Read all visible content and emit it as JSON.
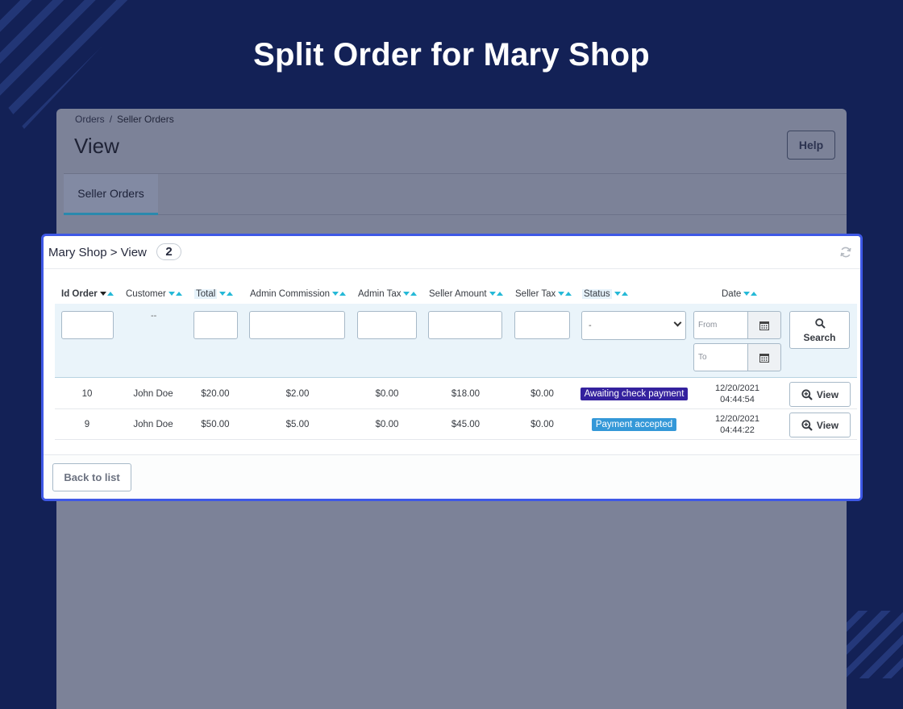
{
  "hero": {
    "title": "Split Order for Mary Shop"
  },
  "backdrop": {
    "breadcrumb": [
      "Orders",
      "Seller Orders"
    ],
    "breadcrumb_sep": "/",
    "title": "View",
    "help_label": "Help",
    "tabs": [
      {
        "label": "Seller Orders",
        "active": true
      }
    ]
  },
  "panel": {
    "title": "Mary Shop > View",
    "count": "2",
    "columns": [
      {
        "label": "Id Order"
      },
      {
        "label": "Customer"
      },
      {
        "label": "Total"
      },
      {
        "label": "Admin Commission"
      },
      {
        "label": "Admin Tax"
      },
      {
        "label": "Seller Amount"
      },
      {
        "label": "Seller Tax"
      },
      {
        "label": "Status"
      },
      {
        "label": "Date"
      }
    ],
    "filters": {
      "customer_placeholder": "--",
      "status_selected": "-",
      "date_from_placeholder": "From",
      "date_to_placeholder": "To",
      "search_label": "Search"
    },
    "rows": [
      {
        "id": "10",
        "customer": "John Doe",
        "total": "$20.00",
        "admin_commission": "$2.00",
        "admin_tax": "$0.00",
        "seller_amount": "$18.00",
        "seller_tax": "$0.00",
        "status": "Awaiting check payment",
        "status_color": "#34219e",
        "date": "12/20/2021",
        "time": "04:44:54",
        "action": "View"
      },
      {
        "id": "9",
        "customer": "John Doe",
        "total": "$50.00",
        "admin_commission": "$5.00",
        "admin_tax": "$0.00",
        "seller_amount": "$45.00",
        "seller_tax": "$0.00",
        "status": "Payment accepted",
        "status_color": "#3498d8",
        "date": "12/20/2021",
        "time": "04:44:22",
        "action": "View"
      }
    ],
    "back_label": "Back to list"
  },
  "colors": {
    "background": "#132156",
    "panel_border": "#3e58e6",
    "accent": "#25b9d7"
  },
  "icons": [
    "refresh-icon",
    "calendar-icon",
    "search-icon",
    "zoom-in-icon"
  ]
}
